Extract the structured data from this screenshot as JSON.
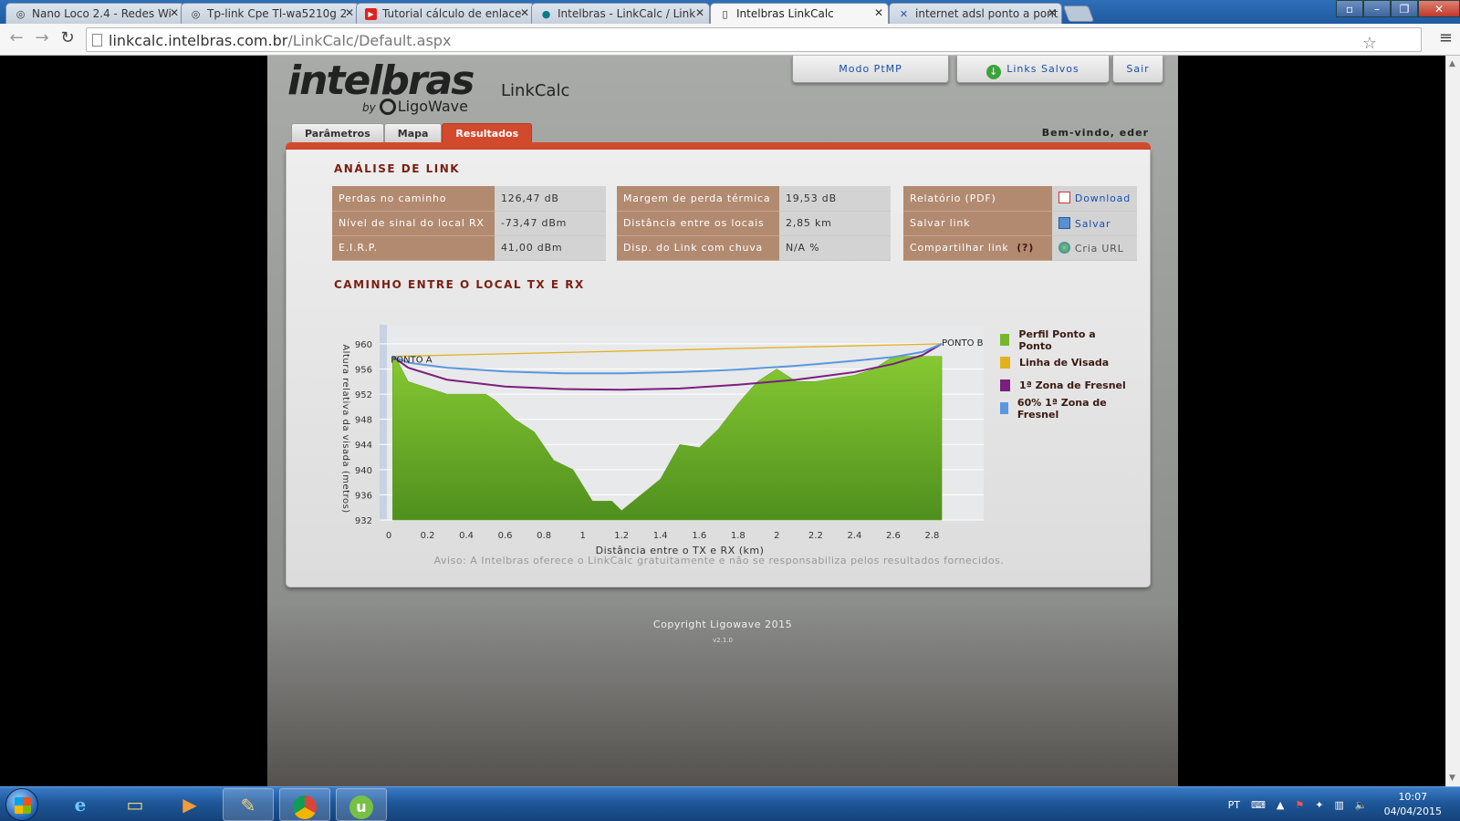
{
  "browser": {
    "tabs": [
      {
        "title": "Nano Loco 2.4 - Redes Wi",
        "icon": "wifi-icon"
      },
      {
        "title": "Tp-link Cpe Tl-wa5210g 2",
        "icon": "wifi-icon"
      },
      {
        "title": "Tutorial cálculo de enlace",
        "icon": "youtube-icon"
      },
      {
        "title": "Intelbras - LinkCalc / Link",
        "icon": "intelbras-icon"
      },
      {
        "title": "Intelbras LinkCalc",
        "icon": "page-icon"
      },
      {
        "title": "internet adsl ponto a pont",
        "icon": "x-icon"
      }
    ],
    "url_host": "linkcalc.intelbras.com.br",
    "url_path": "/LinkCalc/Default.aspx"
  },
  "header": {
    "logo": "intelbras",
    "by": "by",
    "brand": "LigoWave",
    "app_name": "LinkCalc",
    "buttons": {
      "ptmp": "Modo PtMP",
      "saved": "Links Salvos",
      "exit": "Sair"
    },
    "welcome": "Bem-vindo, eder"
  },
  "tabs": [
    {
      "label": "Parâmetros"
    },
    {
      "label": "Mapa"
    },
    {
      "label": "Resultados"
    }
  ],
  "analysis": {
    "title": "ANÁLISE DE LINK",
    "col1": [
      {
        "k": "Perdas no caminho",
        "v": "126,47  dB"
      },
      {
        "k": "Nível de sinal do local RX",
        "v": "-73,47 dBm"
      },
      {
        "k": "E.I.R.P.",
        "v": "41,00 dBm"
      }
    ],
    "col2": [
      {
        "k": "Margem de perda térmica",
        "v": "19,53 dB"
      },
      {
        "k": "Distância entre os locais",
        "v": "2,85 km"
      },
      {
        "k": "Disp. do Link com chuva",
        "v": "N/A %"
      }
    ],
    "col3": [
      {
        "k": "Relatório (PDF)",
        "v": "Download",
        "icon": "pdf-icon"
      },
      {
        "k": "Salvar link",
        "v": "Salvar",
        "icon": "save-icon"
      },
      {
        "k": "Compartilhar link",
        "help": "(?)",
        "v": "Cria URL",
        "icon": "globe-icon"
      }
    ]
  },
  "path_title": "CAMINHO ENTRE O LOCAL TX E RX",
  "chart_data": {
    "type": "area",
    "xlabel": "Distância entre o TX e RX (km)",
    "ylabel": "Altura relativa da visada (metros)",
    "xlim": [
      0,
      3.0
    ],
    "ylim": [
      932,
      961
    ],
    "xticks": [
      "0",
      "0.2",
      "0.4",
      "0.6",
      "0.8",
      "1",
      "1.2",
      "1.4",
      "1.6",
      "1.8",
      "2",
      "2.2",
      "2.4",
      "2.6",
      "2.8"
    ],
    "yticks": [
      "932",
      "936",
      "940",
      "944",
      "948",
      "952",
      "956",
      "960"
    ],
    "annotations": [
      "PONTO A",
      "PONTO B"
    ],
    "series": [
      {
        "name": "Perfil Ponto a Ponto",
        "color": "#77b82a",
        "x": [
          0.02,
          0.05,
          0.1,
          0.2,
          0.3,
          0.4,
          0.5,
          0.55,
          0.65,
          0.75,
          0.85,
          0.95,
          1.05,
          1.15,
          1.2,
          1.3,
          1.4,
          1.5,
          1.6,
          1.7,
          1.8,
          1.9,
          2.0,
          2.1,
          2.2,
          2.3,
          2.4,
          2.5,
          2.6,
          2.7,
          2.8,
          2.85
        ],
        "y": [
          958,
          957,
          954,
          953,
          952,
          952,
          952,
          951,
          948,
          946,
          941.5,
          940,
          935,
          935,
          933.5,
          936,
          938.5,
          944,
          943.5,
          946.5,
          950.5,
          954,
          956,
          954,
          954,
          954.5,
          955,
          956,
          958,
          958,
          958,
          958
        ]
      },
      {
        "name": "Linha de Visada",
        "color": "#e1b21c",
        "x": [
          0.02,
          2.85
        ],
        "y": [
          958,
          960
        ]
      },
      {
        "name": "1ª Zona de Fresnel",
        "color": "#7a1f7d",
        "x": [
          0.02,
          0.1,
          0.3,
          0.6,
          0.9,
          1.2,
          1.5,
          1.8,
          2.1,
          2.4,
          2.6,
          2.75,
          2.85
        ],
        "y": [
          958,
          956.2,
          954.3,
          953.2,
          952.8,
          952.7,
          952.9,
          953.5,
          954.3,
          955.5,
          956.8,
          958.2,
          960
        ]
      },
      {
        "name": "60% 1ª Zona de Fresnel",
        "color": "#5b97de",
        "x": [
          0.02,
          0.1,
          0.3,
          0.6,
          0.9,
          1.2,
          1.5,
          1.8,
          2.1,
          2.4,
          2.6,
          2.75,
          2.85
        ],
        "y": [
          958,
          957,
          956.2,
          955.6,
          955.3,
          955.3,
          955.5,
          955.9,
          956.5,
          957.3,
          957.9,
          958.7,
          960
        ]
      }
    ]
  },
  "aviso": "Aviso: A Intelbras oferece o LinkCalc gratuitamente e não se responsabiliza pelos resultados fornecidos.",
  "footer": {
    "copyright": "Copyright Ligowave 2015",
    "version": "v2.1.0"
  },
  "taskbar": {
    "apps": [
      "ie-icon",
      "explorer-icon",
      "media-player-icon",
      "paint-icon",
      "chrome-icon",
      "utorrent-icon"
    ],
    "lang": "PT",
    "time": "10:07",
    "date": "04/04/2015"
  }
}
